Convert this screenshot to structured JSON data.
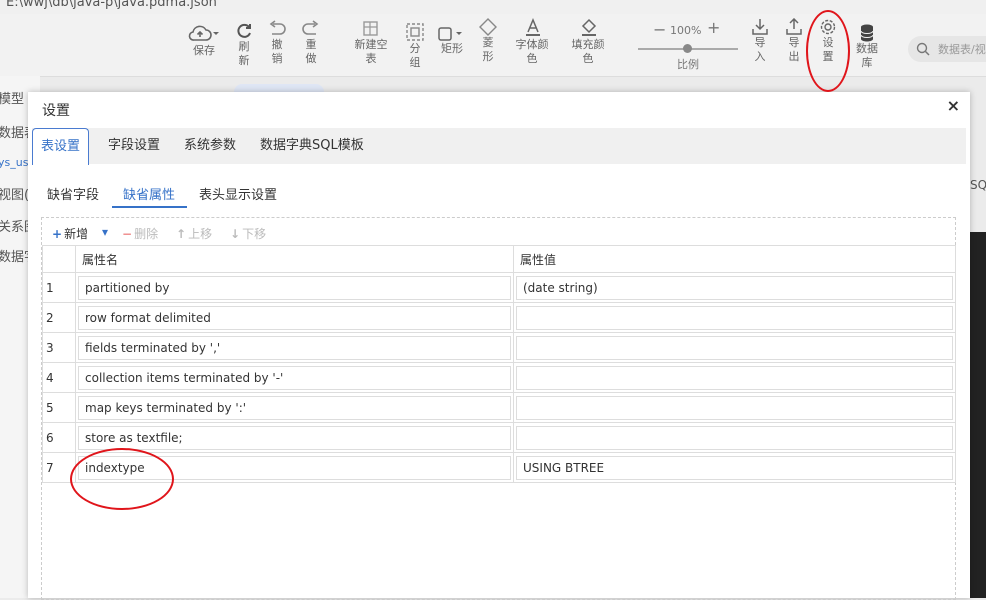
{
  "window": {
    "title": "E:\\wwj\\db\\java-p\\java.pdma.json"
  },
  "toolbar": {
    "save": "保存",
    "refresh": "刷新",
    "undo": "撤销",
    "redo": "重做",
    "new_blank": "新建空表",
    "group": "分组",
    "rect": "矩形",
    "diamond": "菱形",
    "font_color": "字体颜色",
    "fill_color": "填充颜色",
    "zoom_value": "100%",
    "zoom_label": "比例",
    "zoom_level": 0.5,
    "import": "导入",
    "export": "导出",
    "settings": "设置",
    "database": "数据库",
    "search_placeholder": "数据表/视"
  },
  "sidebar": {
    "items": [
      "模型",
      "数据表",
      "ys_us",
      "视图(0",
      "关系图",
      "数据字"
    ]
  },
  "background": {
    "right_text": "SQ"
  },
  "dialog": {
    "title": "设置",
    "close": "×",
    "tabs": [
      "表设置",
      "字段设置",
      "系统参数",
      "数据字典SQL模板"
    ],
    "subtabs": [
      "缺省字段",
      "缺省属性",
      "表头显示设置"
    ],
    "toolbar": {
      "add": "新增",
      "delete": "删除",
      "up": "上移",
      "down": "下移"
    },
    "columns": [
      "属性名",
      "属性值"
    ],
    "rows": [
      {
        "n": "1",
        "name": "partitioned by",
        "value": "(date string)"
      },
      {
        "n": "2",
        "name": "row format delimited",
        "value": ""
      },
      {
        "n": "3",
        "name": "fields terminated by ','",
        "value": ""
      },
      {
        "n": "4",
        "name": "collection items terminated by '-'",
        "value": ""
      },
      {
        "n": "5",
        "name": "map keys terminated by ':'",
        "value": ""
      },
      {
        "n": "6",
        "name": "store as textfile;",
        "value": ""
      },
      {
        "n": "7",
        "name": "indextype",
        "value": "USING BTREE"
      }
    ]
  },
  "colors": {
    "accent": "#3672c8",
    "annotation": "#e0151b"
  }
}
